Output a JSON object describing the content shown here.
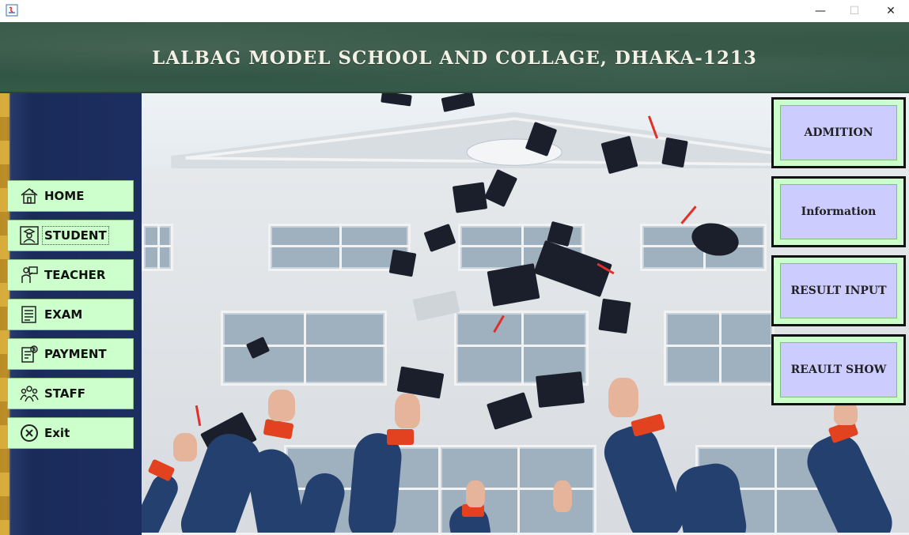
{
  "window": {
    "minimize": "—",
    "maximize": "☐",
    "close": "✕"
  },
  "header": {
    "title": "LALBAG MODEL SCHOOL AND COLLAGE, DHAKA-1213"
  },
  "sidebar": {
    "items": [
      {
        "label": "HOME",
        "icon": "home-icon"
      },
      {
        "label": "STUDENT",
        "icon": "student-icon"
      },
      {
        "label": "TEACHER",
        "icon": "teacher-icon"
      },
      {
        "label": "EXAM",
        "icon": "exam-icon"
      },
      {
        "label": "PAYMENT",
        "icon": "payment-icon"
      },
      {
        "label": "STAFF",
        "icon": "staff-icon"
      },
      {
        "label": "Exit",
        "icon": "exit-icon"
      }
    ]
  },
  "actions": {
    "items": [
      {
        "label": "ADMITION"
      },
      {
        "label": "Information"
      },
      {
        "label": "RESULT INPUT"
      },
      {
        "label": "REAULT SHOW"
      }
    ]
  },
  "colors": {
    "nav_button_bg": "#ccffcc",
    "action_button_bg": "#ccccff",
    "banner_green": "#2f5140",
    "sidebar_navy": "#1a2b5a"
  }
}
